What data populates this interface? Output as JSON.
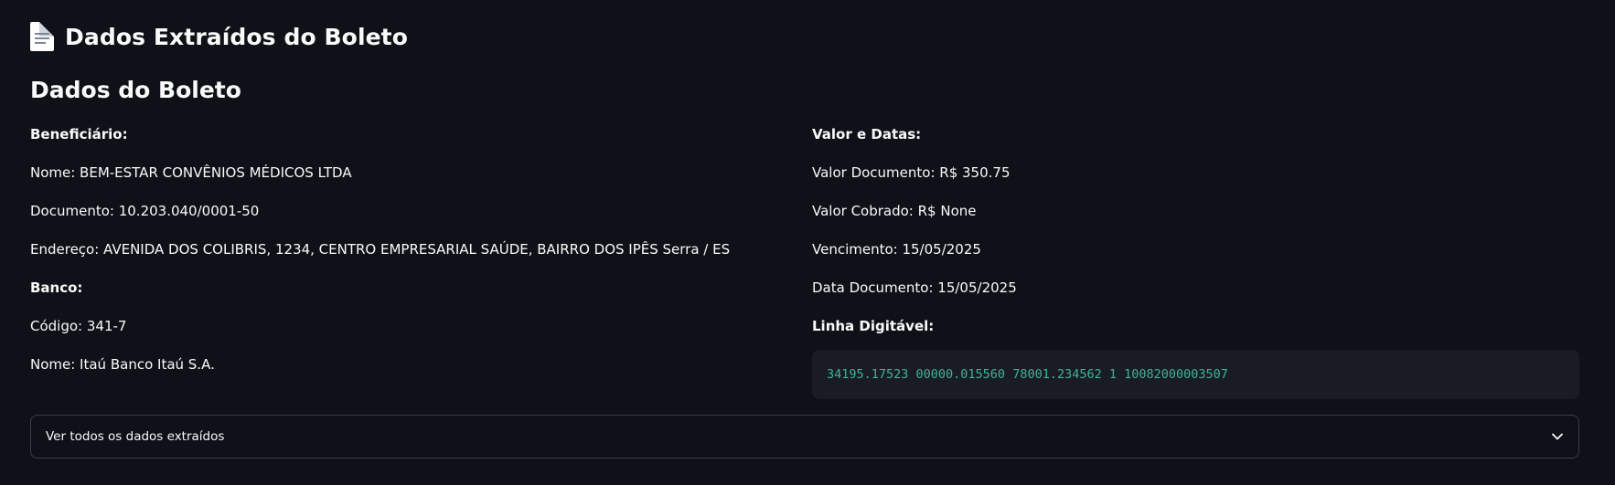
{
  "header": {
    "icon": "document-icon",
    "title": "Dados Extraídos do Boleto"
  },
  "section": {
    "title": "Dados do Boleto"
  },
  "left": {
    "beneficiario_heading": "Beneficiário:",
    "nome": "Nome: BEM-ESTAR CONVÊNIOS MÉDICOS LTDA",
    "documento": "Documento: 10.203.040/0001-50",
    "endereco": "Endereço: AVENIDA DOS COLIBRIS, 1234, CENTRO EMPRESARIAL SAÚDE, BAIRRO DOS IPÊS Serra / ES",
    "banco_heading": "Banco:",
    "codigo": "Código: 341-7",
    "banco_nome": "Nome: Itaú Banco Itaú S.A."
  },
  "right": {
    "valor_heading": "Valor e Datas:",
    "valor_documento": "Valor Documento: R$ 350.75",
    "valor_cobrado": "Valor Cobrado: R$ None",
    "vencimento": "Vencimento: 15/05/2025",
    "data_documento": "Data Documento: 15/05/2025",
    "linha_heading": "Linha Digitável:",
    "linha_digitavel": "34195.17523 00000.015560 78001.234562 1 10082000003507"
  },
  "expander": {
    "label": "Ver todos os dados extraídos",
    "icon": "chevron-down-icon"
  },
  "colors": {
    "background": "#0e1117",
    "text": "#fafafa",
    "code_background": "#1a1c24",
    "code_text": "#3fb394",
    "border": "#3a3d47"
  }
}
